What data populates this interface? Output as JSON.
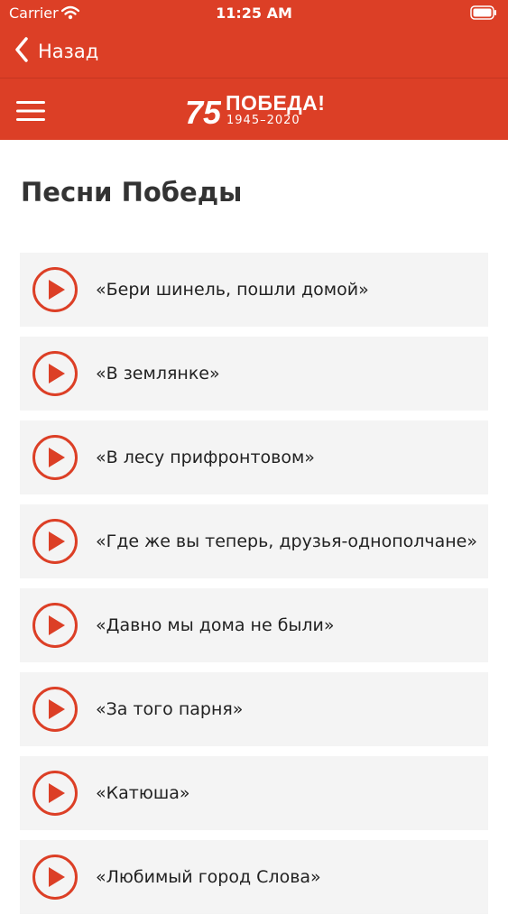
{
  "status_bar": {
    "carrier": "Carrier",
    "time": "11:25 AM",
    "wifi_icon": "wifi-icon",
    "battery_icon": "battery-icon"
  },
  "nav": {
    "back_label": "Назад",
    "back_icon": "chevron-left-icon"
  },
  "header": {
    "menu_icon": "hamburger-menu-icon",
    "logo_number": "75",
    "logo_title": "ПОБЕДА!",
    "logo_years": "1945–2020"
  },
  "page_title": "Песни Победы",
  "songs": [
    {
      "title": "«Бери шинель, пошли домой»"
    },
    {
      "title": "«В землянке»"
    },
    {
      "title": "«В лесу прифронтовом»"
    },
    {
      "title": "«Где же вы теперь, друзья-однополчане»"
    },
    {
      "title": "«Давно мы дома не были»"
    },
    {
      "title": "«За того парня»"
    },
    {
      "title": "«Катюша»"
    },
    {
      "title": "«Любимый город Слова»"
    }
  ],
  "colors": {
    "accent": "#dc3f26",
    "card_background": "#f4f4f4",
    "title_text": "#333333"
  }
}
